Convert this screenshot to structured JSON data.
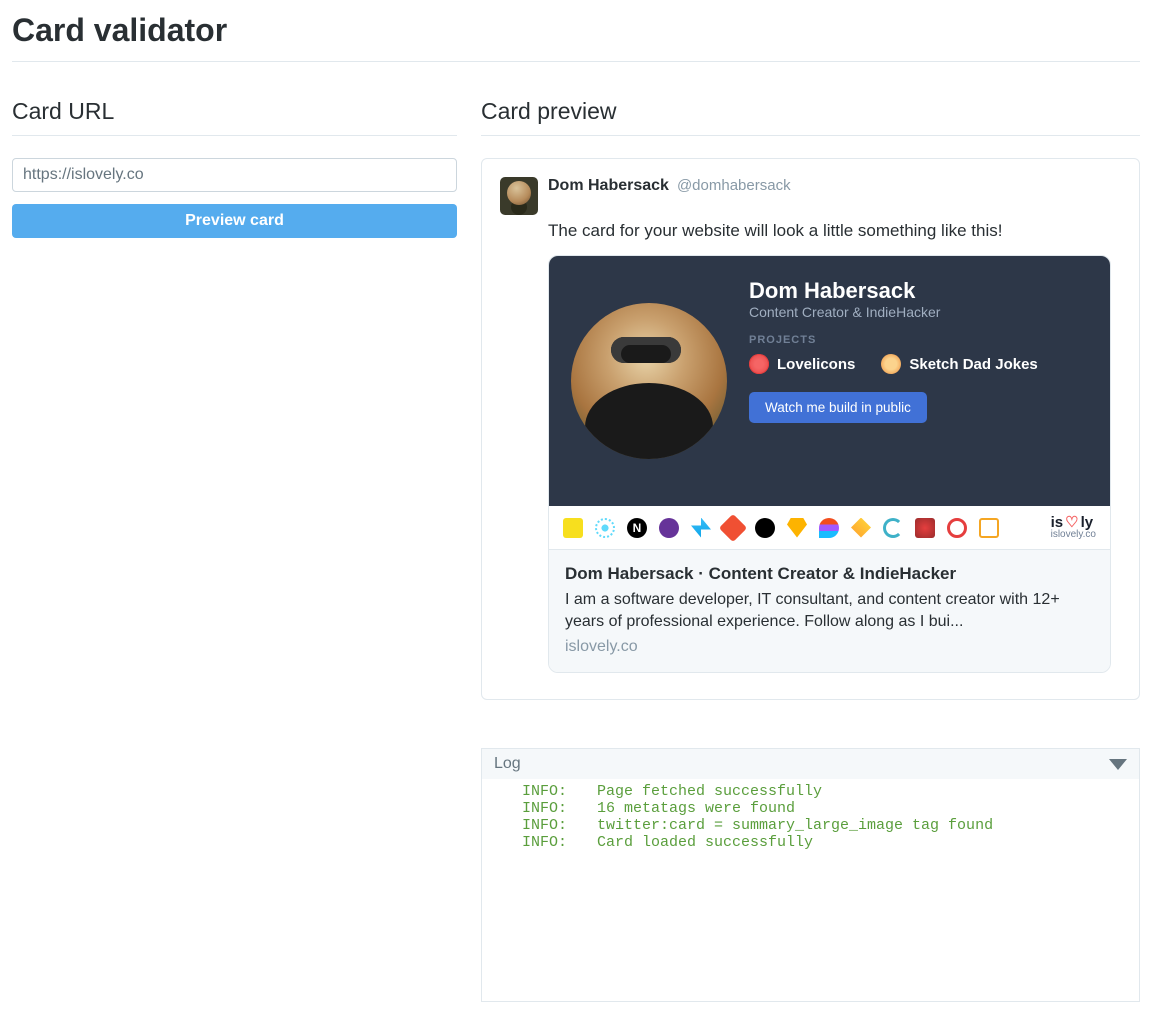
{
  "page_title": "Card validator",
  "left": {
    "section_title": "Card URL",
    "url_value": "https://islovely.co",
    "button_label": "Preview card"
  },
  "preview": {
    "section_title": "Card preview",
    "author_name": "Dom Habersack",
    "author_handle": "@domhabersack",
    "tweet_text": "The card for your website will look a little something like this!",
    "card_image": {
      "name": "Dom Habersack",
      "role": "Content Creator & IndieHacker",
      "projects_label": "PROJECTS",
      "project1": "Lovelicons",
      "project2": "Sketch Dad Jokes",
      "cta": "Watch me build in public",
      "brand_word1": "is",
      "brand_word2": "ly",
      "brand_domain": "islovely.co"
    },
    "card_title": "Dom Habersack · Content Creator & IndieHacker",
    "card_desc": "I am a software developer, IT consultant, and content creator with 12+ years of professional experience. Follow along as I bui...",
    "card_domain": "islovely.co"
  },
  "log": {
    "title": "Log",
    "lines": [
      {
        "level": "INFO:",
        "msg": "Page fetched successfully"
      },
      {
        "level": "INFO:",
        "msg": "16 metatags were found"
      },
      {
        "level": "INFO:",
        "msg": "twitter:card = summary_large_image tag found"
      },
      {
        "level": "INFO:",
        "msg": "Card loaded successfully"
      }
    ]
  }
}
